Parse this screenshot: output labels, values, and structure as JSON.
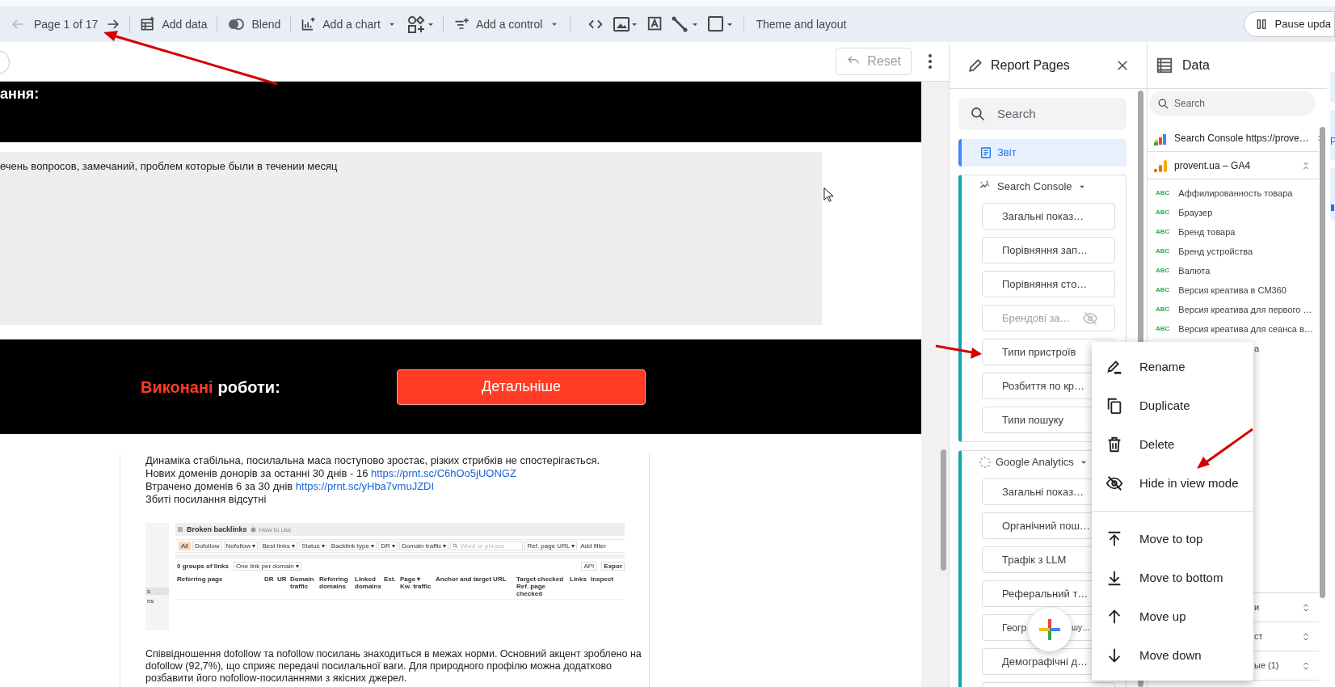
{
  "toolbar": {
    "previous_disabled": true,
    "page_indicator": "Page 1 of 17",
    "add_data": "Add data",
    "blend": "Blend",
    "add_chart": "Add a chart",
    "add_control": "Add a control",
    "theme_and_layout": "Theme and layout",
    "pause_button": "Pause upda"
  },
  "canvas": {
    "reset_button": "Reset",
    "reset_disabled": true,
    "heading_fragment": "ання:",
    "notes_text": "ечень вопросов, замечаний, проблем которые были в течении месяц",
    "section_title_accent": "Виконані",
    "section_title_rest": "роботи:",
    "details_button": "Детальніше",
    "lines": [
      {
        "text": "Динаміка стабільна, посилальна маса поступово зростає, різких стрибків не спостерігається."
      },
      {
        "text": "Нових доменів донорів за останні 30 днів - 16 ",
        "link": "https://prnt.sc/C6hOo5jUONGZ"
      },
      {
        "text": "Втрачено доменів 6 за 30 днів ",
        "link": "https://prnt.sc/yHba7vmuJZDI"
      },
      {
        "text": "Збиті посилання відсутні"
      }
    ],
    "embedded_screenshot": {
      "side_fragments": [
        "s",
        "ns"
      ],
      "title": "Broken backlinks",
      "help_link": "How to use",
      "filters": [
        {
          "label": "All",
          "selected": true
        },
        {
          "label": "Dofollow",
          "selected": false
        },
        {
          "label": "Nofollow ▾",
          "selected": false
        },
        {
          "label": "Best links ▾",
          "selected": false
        },
        {
          "label": "Status ▾",
          "selected": false
        },
        {
          "label": "Backlink type ▾",
          "selected": false
        },
        {
          "label": "DR ▾",
          "selected": false
        },
        {
          "label": "Domain traffic ▾",
          "selected": false
        }
      ],
      "search_placeholder": "Word or phrase",
      "ref_page_filter": "Ref. page URL ▾",
      "add_filter": "Add filter",
      "groups_count": "0 groups of links",
      "grouping": "One link per domain ▾",
      "api_button": "API",
      "export_button": "Expor",
      "columns": [
        "Referring page",
        "DR",
        "UR",
        "Domain traffic",
        "Referring domains",
        "Linked domains",
        "Ext.",
        "Page ▾ Kw. traffic",
        "Anchor and target URL",
        "Target checked Ref. page checked",
        "Links",
        "Inspect"
      ]
    },
    "summary": "Співвідношення dofollow та nofollow посилань знаходиться в межах норми. Основний акцент зроблено на dofollow (92,7%), що сприяє передачі посилальної ваги. Для природного профілю можна додатково розбавити його nofollow-посиланнями з якісних джерел."
  },
  "report_pages": {
    "title": "Report Pages",
    "search_placeholder": "Search",
    "top_pages": [
      {
        "label": "Звіт",
        "selected": true
      }
    ],
    "groups": [
      {
        "title": "Search Console",
        "kind": "sparkle",
        "pages": [
          {
            "label": "Загальні показ…",
            "hidden": false
          },
          {
            "label": "Порівняння зап…",
            "hidden": false
          },
          {
            "label": "Порівняння сто…",
            "hidden": false
          },
          {
            "label": "Брендові за…",
            "hidden": true
          },
          {
            "label": "Типи пристроїв",
            "hidden": false
          },
          {
            "label": "Розбиття по кр…",
            "hidden": false
          },
          {
            "label": "Типи пошуку",
            "hidden": false
          }
        ]
      },
      {
        "title": "Google Analytics",
        "kind": "loading",
        "pages": [
          {
            "label": "Загальні показ…",
            "hidden": false
          },
          {
            "label": "Органічний пош…",
            "hidden": false
          },
          {
            "label": "Трафік з LLM",
            "hidden": false
          },
          {
            "label": "Реферальний т…",
            "hidden": false
          },
          {
            "label": "Геогр",
            "label_end": "шу…",
            "hidden": false
          },
          {
            "label": "Демографічні д…",
            "hidden": false
          },
          {
            "kind": "partial"
          }
        ]
      }
    ]
  },
  "data_panel": {
    "title": "Data",
    "search_placeholder": "Search",
    "sources": [
      {
        "label": "Search Console https://prove…",
        "kind": "console",
        "expanded": false
      },
      {
        "label": "provent.ua – GA4",
        "kind": "analytics",
        "expanded": true
      }
    ],
    "fields": [
      {
        "type": "ABC",
        "label": "Аффилированность товара"
      },
      {
        "type": "ABC",
        "label": "Браузер"
      },
      {
        "type": "ABC",
        "label": "Бренд товара"
      },
      {
        "type": "ABC",
        "label": "Бренд устройства"
      },
      {
        "type": "ABC",
        "label": "Валюта"
      },
      {
        "type": "ABC",
        "label": "Версия креатива в CM360"
      },
      {
        "type": "ABC",
        "label": "Версия креатива для первого …"
      },
      {
        "type": "ABC",
        "label": "Версия креатива для сеанса в…"
      }
    ],
    "hidden_field_fragment": "а",
    "lower_rows": [
      "и",
      "ст",
      "ые (1)"
    ]
  },
  "side_strip": {
    "fragment": "P"
  },
  "context_menu": {
    "groups": [
      [
        {
          "label": "Rename",
          "kind": "rename"
        },
        {
          "label": "Duplicate",
          "kind": "duplicate"
        },
        {
          "label": "Delete",
          "kind": "delete"
        },
        {
          "label": "Hide in view mode",
          "kind": "hide"
        }
      ],
      [
        {
          "label": "Move to top",
          "kind": "top"
        },
        {
          "label": "Move to bottom",
          "kind": "bottom"
        },
        {
          "label": "Move up",
          "kind": "up"
        },
        {
          "label": "Move down",
          "kind": "down"
        }
      ]
    ]
  }
}
